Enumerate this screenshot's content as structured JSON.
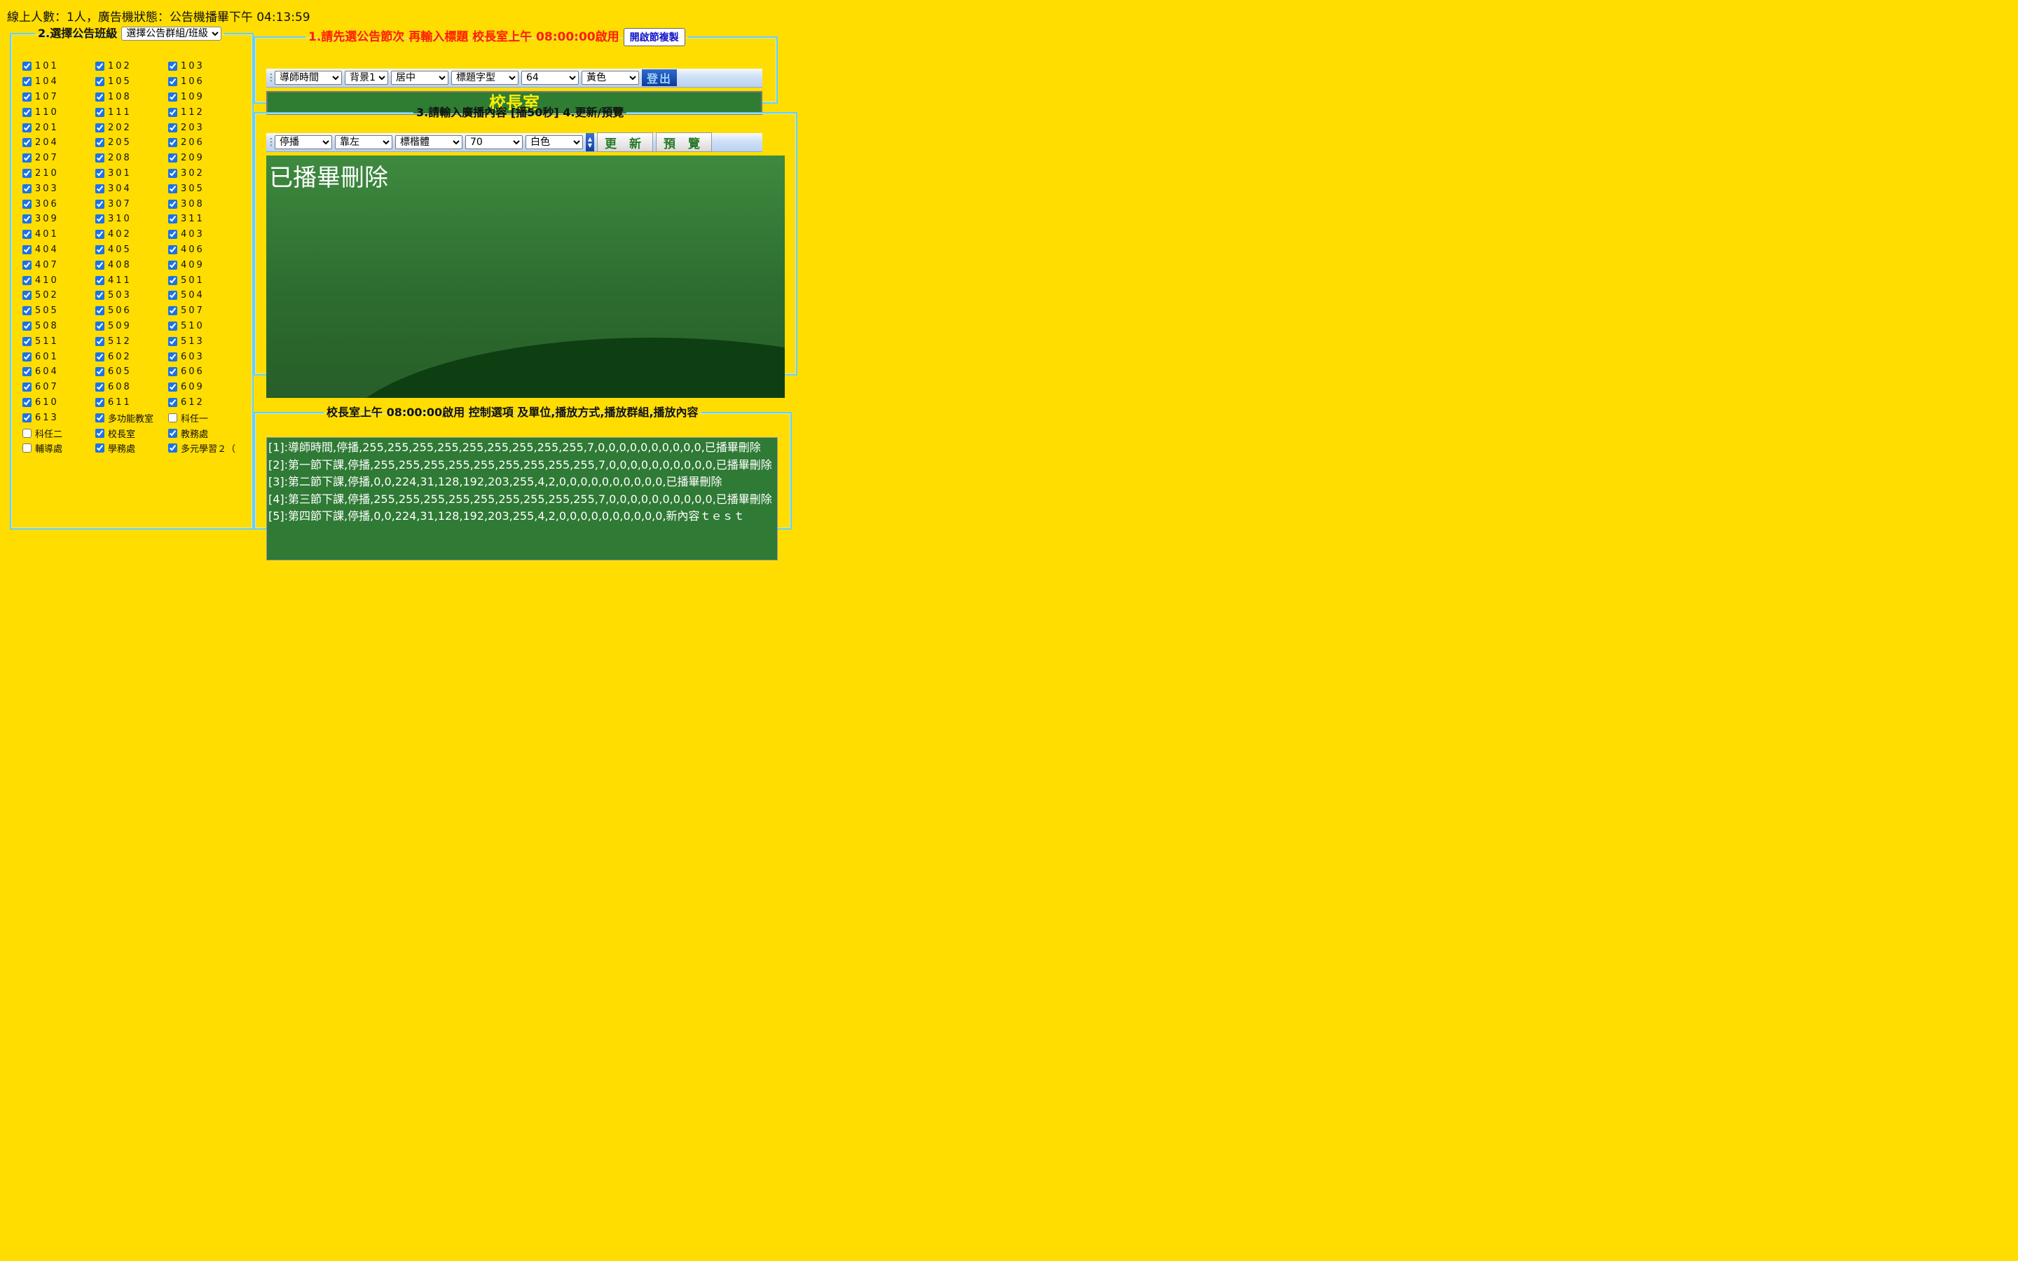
{
  "status": "線上人數：1人，廣告機狀態：公告機播畢下午 04:13:59",
  "class_panel": {
    "legend": "2.選擇公告班級",
    "group_select": "選擇公告群組/班級",
    "classes": [
      {
        "label": "101",
        "checked": true
      },
      {
        "label": "102",
        "checked": true
      },
      {
        "label": "103",
        "checked": true
      },
      {
        "label": "104",
        "checked": true
      },
      {
        "label": "105",
        "checked": true
      },
      {
        "label": "106",
        "checked": true
      },
      {
        "label": "107",
        "checked": true
      },
      {
        "label": "108",
        "checked": true
      },
      {
        "label": "109",
        "checked": true
      },
      {
        "label": "110",
        "checked": true
      },
      {
        "label": "111",
        "checked": true
      },
      {
        "label": "112",
        "checked": true
      },
      {
        "label": "201",
        "checked": true
      },
      {
        "label": "202",
        "checked": true
      },
      {
        "label": "203",
        "checked": true
      },
      {
        "label": "204",
        "checked": true
      },
      {
        "label": "205",
        "checked": true
      },
      {
        "label": "206",
        "checked": true
      },
      {
        "label": "207",
        "checked": true
      },
      {
        "label": "208",
        "checked": true
      },
      {
        "label": "209",
        "checked": true
      },
      {
        "label": "210",
        "checked": true
      },
      {
        "label": "301",
        "checked": true
      },
      {
        "label": "302",
        "checked": true
      },
      {
        "label": "303",
        "checked": true
      },
      {
        "label": "304",
        "checked": true
      },
      {
        "label": "305",
        "checked": true
      },
      {
        "label": "306",
        "checked": true
      },
      {
        "label": "307",
        "checked": true
      },
      {
        "label": "308",
        "checked": true
      },
      {
        "label": "309",
        "checked": true
      },
      {
        "label": "310",
        "checked": true
      },
      {
        "label": "311",
        "checked": true
      },
      {
        "label": "401",
        "checked": true
      },
      {
        "label": "402",
        "checked": true
      },
      {
        "label": "403",
        "checked": true
      },
      {
        "label": "404",
        "checked": true
      },
      {
        "label": "405",
        "checked": true
      },
      {
        "label": "406",
        "checked": true
      },
      {
        "label": "407",
        "checked": true
      },
      {
        "label": "408",
        "checked": true
      },
      {
        "label": "409",
        "checked": true
      },
      {
        "label": "410",
        "checked": true
      },
      {
        "label": "411",
        "checked": true
      },
      {
        "label": "501",
        "checked": true
      },
      {
        "label": "502",
        "checked": true
      },
      {
        "label": "503",
        "checked": true
      },
      {
        "label": "504",
        "checked": true
      },
      {
        "label": "505",
        "checked": true
      },
      {
        "label": "506",
        "checked": true
      },
      {
        "label": "507",
        "checked": true
      },
      {
        "label": "508",
        "checked": true
      },
      {
        "label": "509",
        "checked": true
      },
      {
        "label": "510",
        "checked": true
      },
      {
        "label": "511",
        "checked": true
      },
      {
        "label": "512",
        "checked": true
      },
      {
        "label": "513",
        "checked": true
      },
      {
        "label": "601",
        "checked": true
      },
      {
        "label": "602",
        "checked": true
      },
      {
        "label": "603",
        "checked": true
      },
      {
        "label": "604",
        "checked": true
      },
      {
        "label": "605",
        "checked": true
      },
      {
        "label": "606",
        "checked": true
      },
      {
        "label": "607",
        "checked": true
      },
      {
        "label": "608",
        "checked": true
      },
      {
        "label": "609",
        "checked": true
      },
      {
        "label": "610",
        "checked": true
      },
      {
        "label": "611",
        "checked": true
      },
      {
        "label": "612",
        "checked": true
      },
      {
        "label": "613",
        "checked": true
      },
      {
        "label": "多功能教室",
        "checked": true
      },
      {
        "label": "科任一",
        "checked": false
      },
      {
        "label": "科任二",
        "checked": false
      },
      {
        "label": "校長室",
        "checked": true
      },
      {
        "label": "教務處",
        "checked": true
      },
      {
        "label": "輔導處",
        "checked": false
      },
      {
        "label": "學務處",
        "checked": true
      },
      {
        "label": "多元學習２（",
        "checked": true
      }
    ]
  },
  "title_panel": {
    "legend": "1.請先選公告節次 再輸入標題 校長室上午 08:00:00啟用",
    "copy_button": "開啟節複製",
    "selects": [
      "導師時間",
      "背景1",
      "居中",
      "標題字型",
      "64",
      "黃色"
    ],
    "logout_label": "登出",
    "title_text": "校長室"
  },
  "content_panel": {
    "legend": "3.請輸入廣播內容 [播50秒] 4.更新/預覽",
    "selects": [
      "停播",
      "靠左",
      "標楷體",
      "70",
      "白色"
    ],
    "update_button": "更 新",
    "preview_button": "預 覽",
    "content_text": "已播畢刪除"
  },
  "summary_panel": {
    "legend": "校長室上午 08:00:00啟用 控制選項 及單位,播放方式,播放群組,播放內容",
    "lines": [
      "[1]:導師時間,停播,255,255,255,255,255,255,255,255,255,7,0,0,0,0,0,0,0,0,0,0,已播畢刪除",
      "[2]:第一節下課,停播,255,255,255,255,255,255,255,255,255,7,0,0,0,0,0,0,0,0,0,0,已播畢刪除",
      "[3]:第二節下課,停播,0,0,224,31,128,192,203,255,4,2,0,0,0,0,0,0,0,0,0,0,已播畢刪除",
      "[4]:第三節下課,停播,255,255,255,255,255,255,255,255,255,7,0,0,0,0,0,0,0,0,0,0,已播畢刪除",
      "[5]:第四節下課,停播,0,0,224,31,128,192,203,255,4,2,0,0,0,0,0,0,0,0,0,0,新內容ｔｅｓｔ"
    ]
  }
}
